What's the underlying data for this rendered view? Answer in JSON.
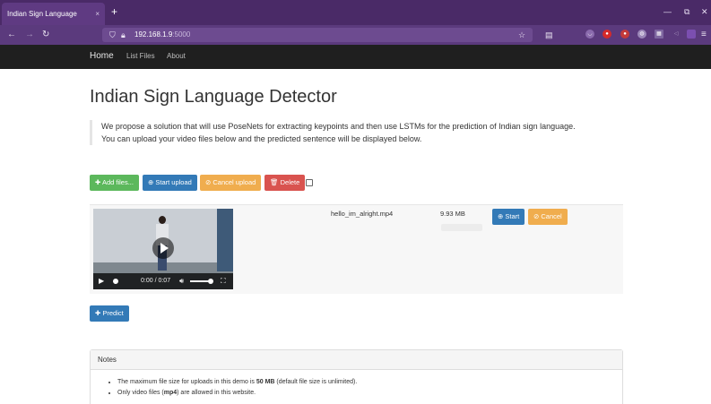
{
  "browser": {
    "tab_title": "Indian Sign Language Detector",
    "tab_close": "×",
    "new_tab": "+",
    "url_host": "192.168.1.9",
    "url_port": ":5000",
    "window_controls": [
      "—",
      "⧉",
      "✕"
    ]
  },
  "site_nav": {
    "brand": "Home",
    "links": [
      "List Files",
      "About"
    ]
  },
  "page": {
    "title": "Indian Sign Language Detector",
    "lead_line1": "We propose a solution that will use PoseNets for extracting keypoints and then use LSTMs for the prediction of Indian sign language.",
    "lead_line2": "You can upload your video files below and the predicted sentence will be displayed below."
  },
  "toolbar": {
    "add_files": "✚ Add files...",
    "start_upload": "⊕ Start upload",
    "cancel_upload": "⊘ Cancel upload",
    "delete": "🗑 Delete"
  },
  "file_row": {
    "filename": "hello_im_alright.mp4",
    "size": "9.93 MB",
    "progress": 0,
    "start": "⊕ Start",
    "cancel": "⊘ Cancel",
    "video_time": "0:00 / 0:07"
  },
  "predict_button": "✚ Predict",
  "notes": {
    "heading": "Notes",
    "item1_prefix": "The maximum file size for uploads in this demo is ",
    "item1_bold": "50 MB",
    "item1_suffix": " (default file size is unlimited).",
    "item2_prefix": "Only video files (",
    "item2_bold": "mp4",
    "item2_suffix": ") are allowed in this website."
  },
  "colors": {
    "browser_frame": "#4a2a67",
    "site_nav_bg": "#1f1f1f",
    "success": "#5cb85c",
    "primary": "#337ab7",
    "warning": "#f0ad4e",
    "danger": "#d9534f"
  }
}
